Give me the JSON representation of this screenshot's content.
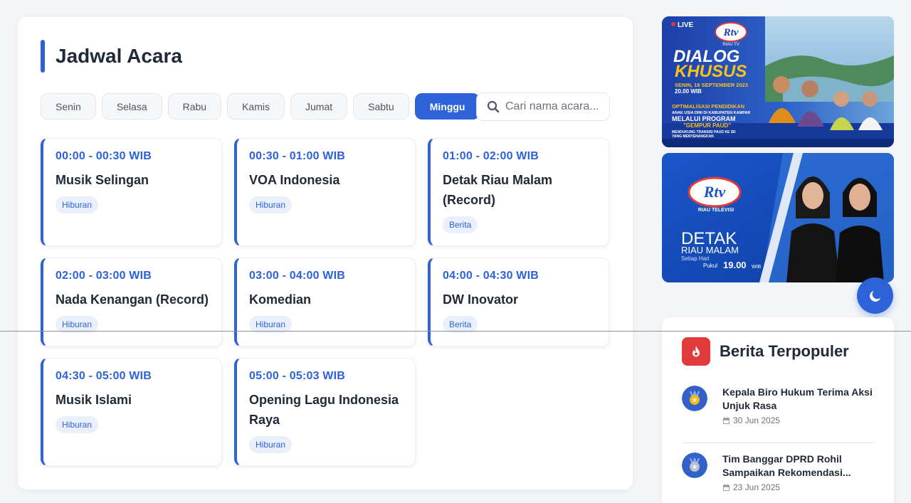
{
  "schedule": {
    "title": "Jadwal Acara",
    "days": [
      "Senin",
      "Selasa",
      "Rabu",
      "Kamis",
      "Jumat",
      "Sabtu",
      "Minggu"
    ],
    "active_day": "Minggu",
    "search_placeholder": "Cari nama acara...",
    "programs": [
      {
        "time": "00:00 - 00:30 WIB",
        "name": "Musik Selingan",
        "category": "Hiburan"
      },
      {
        "time": "00:30 - 01:00 WIB",
        "name": "VOA Indonesia",
        "category": "Hiburan"
      },
      {
        "time": "01:00 - 02:00 WIB",
        "name": "Detak Riau Malam (Record)",
        "category": "Berita"
      },
      {
        "time": "02:00 - 03:00 WIB",
        "name": "Nada Kenangan (Record)",
        "category": "Hiburan"
      },
      {
        "time": "03:00 - 04:00 WIB",
        "name": "Komedian",
        "category": "Hiburan"
      },
      {
        "time": "04:00 - 04:30 WIB",
        "name": "DW Inovator",
        "category": "Berita"
      },
      {
        "time": "04:30 - 05:00 WIB",
        "name": "Musik Islami",
        "category": "Hiburan"
      },
      {
        "time": "05:00 - 05:03 WIB",
        "name": "Opening Lagu Indonesia Raya",
        "category": "Hiburan"
      }
    ]
  },
  "banner1": {
    "live": "LIVE",
    "logo": "Rtv",
    "logo_sub": "RIAU TV",
    "title1": "DIALOG",
    "title2": "KHUSUS",
    "date": "SENIN, 18 SEPTEMBER 2023",
    "time": "20.00 WIB",
    "topic1": "OPTIMALISASI PENDIDIKAN",
    "topic2": "ANAK USIA DINI DI KABUPATEN KAMPAR",
    "topic3": "MELALUI PROGRAM",
    "topic4": "\"GEMPUR PAUD\"",
    "topic5": "MENDUKUNG TRANSISI PAUD KE SD",
    "topic6": "YANG MENYENANGKAN"
  },
  "banner2": {
    "logo": "Rtv",
    "logo_sub": "RIAU TELEVISI",
    "line1": "DETAK",
    "line2": "RIAU MALAM",
    "line3": "Setiap Hari",
    "pukul": "Pukul",
    "time": "19.00",
    "wib": "WIB"
  },
  "popular": {
    "title": "Berita Terpopuler",
    "items": [
      {
        "title": "Kepala Biro Hukum Terima Aksi Unjuk Rasa",
        "date": "30 Jun 2025",
        "medal": "gold"
      },
      {
        "title": "Tim Banggar DPRD Rohil Sampaikan Rekomendasi...",
        "date": "23 Jun 2025",
        "medal": "silver"
      }
    ]
  },
  "colors": {
    "accent": "#2d62d9",
    "fire": "#e03a3a",
    "gold": "#f2b81f",
    "silver": "#b8c1cc"
  },
  "icons": {
    "search": "search-icon",
    "moon": "moon-icon",
    "fire": "fire-icon",
    "calendar": "calendar-icon",
    "medal": "medal-icon"
  }
}
